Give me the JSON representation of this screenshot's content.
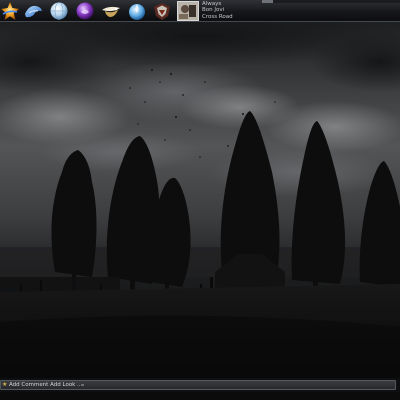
{
  "dock": {
    "icons": [
      "star-burst-icon",
      "blue-bird-icon",
      "globe-icon",
      "purple-orb-icon",
      "lamp-icon",
      "water-drop-icon",
      "emblem-icon"
    ],
    "accent": "#3a6fd8"
  },
  "now_playing": {
    "title": "Always",
    "artist": "Bon Jovi",
    "album": "Cross Road",
    "progress": 0.08
  },
  "wallpaper": {
    "description_icon": "dark-stormy-trees-wallpaper"
  },
  "bottom_bar": {
    "comment_label": "Add Comment  Add  Look  ..."
  },
  "colors": {
    "dock_bg": "#17181b",
    "text": "#c7c9cd",
    "wallpaper_sky": "#5a5b5e"
  }
}
